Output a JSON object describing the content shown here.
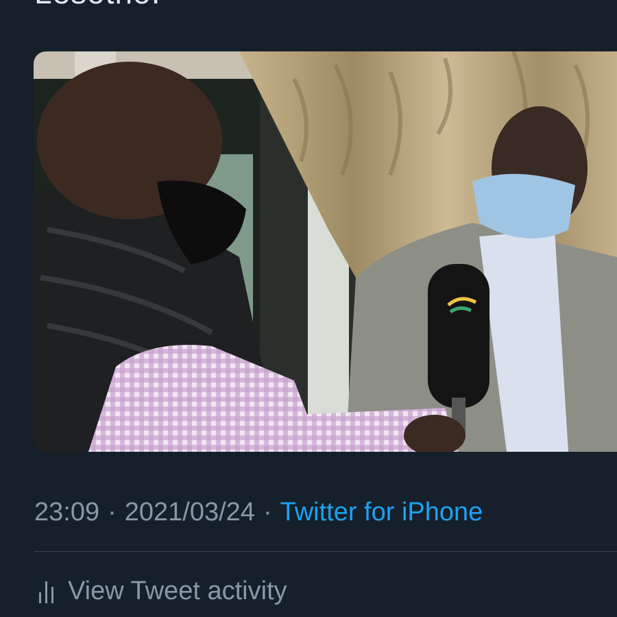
{
  "tweet": {
    "text_fragment": "Lesotho.",
    "time": "23:09",
    "separator": "·",
    "date": "2021/03/24",
    "source": "Twitter for iPhone",
    "activity_label": "View Tweet activity",
    "activity_icon": "bar-chart-icon"
  },
  "colors": {
    "background": "#15202b",
    "link": "#1da1f2",
    "muted": "#8899a6"
  }
}
